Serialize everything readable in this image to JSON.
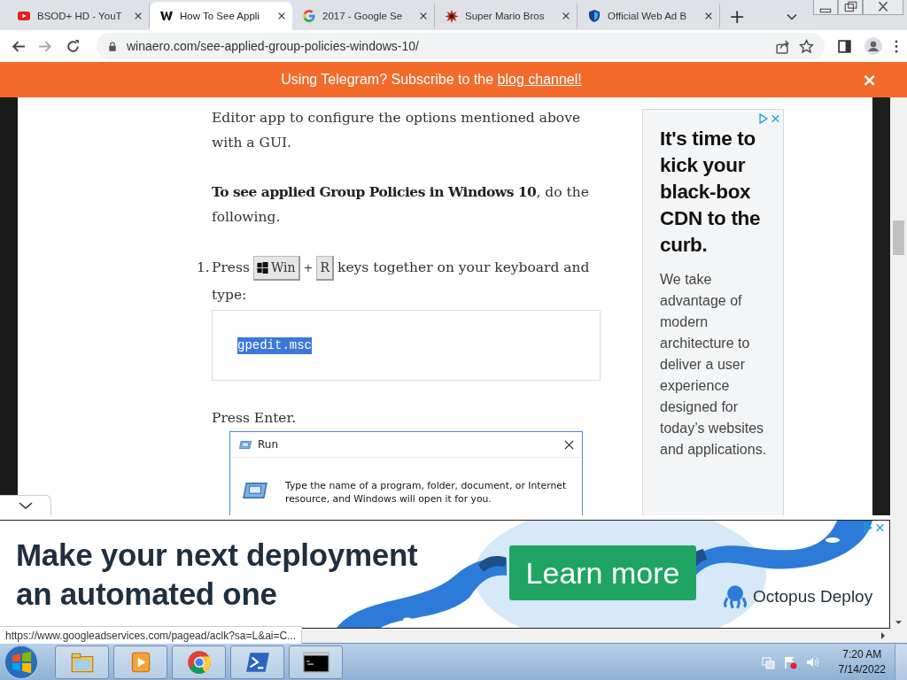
{
  "browser": {
    "tabs": [
      {
        "title": "BSOD+ HD - YouT",
        "selected": false
      },
      {
        "title": "How To See Appli",
        "selected": true
      },
      {
        "title": "2017 - Google Se",
        "selected": false
      },
      {
        "title": "Super Mario Bros",
        "selected": false
      },
      {
        "title": "Official Web Ad B",
        "selected": false
      }
    ],
    "new_tab": "+",
    "address": "winaero.com/see-applied-group-policies-windows-10/"
  },
  "banner": {
    "text": "Using Telegram? Subscribe to the ",
    "link": "blog channel!",
    "close": "×"
  },
  "article": {
    "paragraphs": [
      "Editor app to configure the options mentioned above with a GUI.",
      "**To see applied Group Policies in Windows 10**, do the following."
    ],
    "step": {
      "number": "1.",
      "before": "Press",
      "key_1": "Win",
      "plus": "+",
      "key_2": "R",
      "after": "keys together on your keyboard and",
      "after_line_2": "type:"
    },
    "code": {
      "text": "gpedit.msc",
      "selected": true
    },
    "after_code": "Press Enter.",
    "run_dialog": {
      "title": "Run",
      "text": "Type the name of a program, folder, document, or Internet resource, and Windows will open it for you."
    }
  },
  "side_ad": {
    "headline": "It's time to kick your black-box CDN to the curb.",
    "body": "We take advantage of modern architecture to deliver a user experience designed for today’s websites and applications."
  },
  "bottom_ad": {
    "headline": "Make your next deployment an automated one",
    "button": "Learn more",
    "brand": "Octopus Deploy"
  },
  "status_url": "https://www.googleadservices.com/pagead/aclk?sa=L&ai=C...",
  "taskbar": {
    "apps": [
      {
        "kind": "explorer"
      },
      {
        "kind": "media"
      },
      {
        "kind": "chrome"
      },
      {
        "kind": "powershell"
      },
      {
        "kind": "cmd"
      }
    ],
    "time": "7:20 AM",
    "date": "7/14/2022"
  }
}
